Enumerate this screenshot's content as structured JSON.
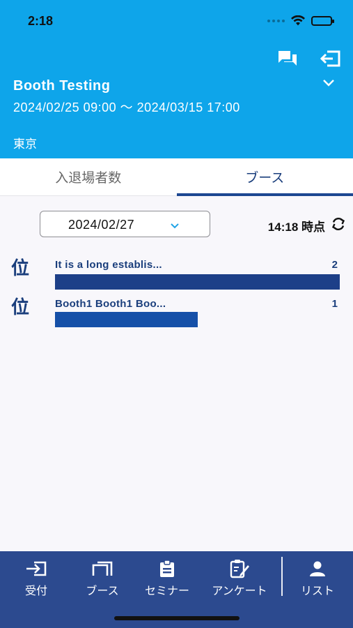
{
  "status_bar": {
    "time": "2:18"
  },
  "event": {
    "title": "Booth Testing",
    "dates": "2024/02/25 09:00 ～ 2024/03/15 17:00",
    "place": "東京"
  },
  "tabs": [
    {
      "label": "入退場者数",
      "active": false
    },
    {
      "label": "ブース",
      "active": true
    }
  ],
  "filter": {
    "date": "2024/02/27",
    "as_of": "14:18 時点"
  },
  "ranking": [
    {
      "rank_mark": "位",
      "name": "It is a long establis...",
      "count": 2,
      "bar_color": "#1d3f88"
    },
    {
      "rank_mark": "位",
      "name": "Booth1 Booth1 Boo...",
      "count": 1,
      "bar_color": "#1650a8"
    }
  ],
  "ranking_max": 2,
  "bottom_nav": [
    {
      "label": "受付",
      "icon": "login-icon"
    },
    {
      "label": "ブース",
      "icon": "booth-icon"
    },
    {
      "label": "セミナー",
      "icon": "clipboard-icon"
    },
    {
      "label": "アンケート",
      "icon": "survey-icon"
    },
    {
      "label": "リスト",
      "icon": "person-icon"
    }
  ],
  "colors": {
    "header": "#0ea5ea",
    "nav": "#2c4a8f",
    "accent": "#1d4791"
  }
}
